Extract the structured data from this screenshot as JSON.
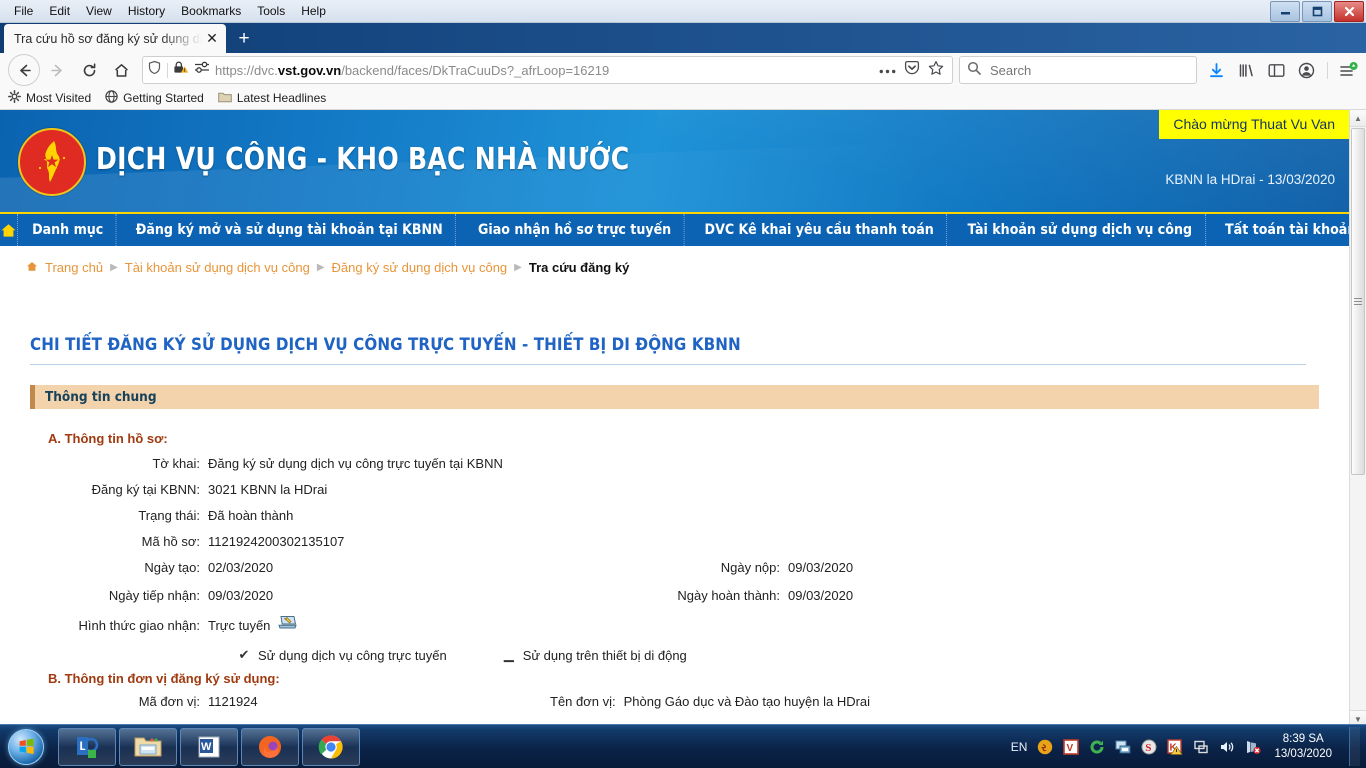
{
  "browser": {
    "menus": [
      "File",
      "Edit",
      "View",
      "History",
      "Bookmarks",
      "Tools",
      "Help"
    ],
    "tab_title": "Tra cứu hồ sơ đăng ký sử dụng dịch",
    "new_tab_label": "+",
    "close_tab_label": "✕",
    "url_prefix": "https://dvc.",
    "url_domain": "vst.gov.vn",
    "url_suffix": "/backend/faces/DkTraCuuDs?_afrLoop=16219",
    "search_placeholder": "Search",
    "bookmarks": [
      "Most Visited",
      "Getting Started",
      "Latest Headlines"
    ],
    "window_controls": {
      "minimize": "—",
      "maximize": "❐",
      "close": "✕"
    }
  },
  "site": {
    "title": "DỊCH VỤ CÔNG - KHO BẠC NHÀ NƯỚC",
    "welcome": "Chào mừng Thuat Vu Van",
    "office_date": "KBNN la HDrai - 13/03/2020",
    "nav": [
      "Danh mục",
      "Đăng ký mở và sử dụng tài khoản tại KBNN",
      "Giao nhận hồ sơ trực tuyến",
      "DVC Kê khai yêu cầu thanh toán",
      "Tài khoản sử dụng dịch vụ công",
      "Tất toán tài khoản"
    ]
  },
  "breadcrumb": {
    "items": [
      "Trang chủ",
      "Tài khoản sử dụng dịch vụ công",
      "Đăng ký sử dụng dịch vụ công"
    ],
    "current": "Tra cứu đăng ký",
    "separator": "▶"
  },
  "page": {
    "title": "CHI TIẾT ĐĂNG KÝ SỬ DỤNG DỊCH VỤ CÔNG TRỰC TUYẾN - THIẾT BỊ DI ĐỘNG KBNN",
    "section_title": "Thông tin chung",
    "section_a_title": "A. Thông tin hồ sơ:",
    "section_b_title": "B. Thông tin đơn vị đăng ký sử dụng:",
    "fields": {
      "to_khai_label": "Tờ khai:",
      "to_khai_value": "Đăng ký sử dụng dịch vụ công trực tuyến tại KBNN",
      "dang_ky_label": "Đăng ký tại KBNN:",
      "dang_ky_value": "3021  KBNN la HDrai",
      "trang_thai_label": "Trạng thái:",
      "trang_thai_value": "Đã hoàn thành",
      "ma_ho_so_label": "Mã hồ sơ:",
      "ma_ho_so_value": "1121924200302135107",
      "ngay_tao_label": "Ngày tạo:",
      "ngay_tao_value": "02/03/2020",
      "ngay_nop_label": "Ngày nộp:",
      "ngay_nop_value": "09/03/2020",
      "ngay_tiep_nhan_label": "Ngày tiếp nhận:",
      "ngay_tiep_nhan_value": "09/03/2020",
      "ngay_hoan_thanh_label": "Ngày hoàn thành:",
      "ngay_hoan_thanh_value": "09/03/2020",
      "hinh_thuc_label": "Hình thức giao nhận:",
      "hinh_thuc_value": "Trực tuyến",
      "check1_mark": "✔",
      "check1_label": "Sử dụng dịch vụ công trực tuyến",
      "check2_mark": "▁",
      "check2_label": "Sử dụng trên thiết bị di động",
      "ma_don_vi_label": "Mã đơn vị:",
      "ma_don_vi_value": "1121924",
      "ten_don_vi_label": "Tên đơn vị:",
      "ten_don_vi_value": "Phòng Gáo dục và Đào tạo huyện la HDrai"
    }
  },
  "taskbar": {
    "language": "EN",
    "time": "8:39 SA",
    "date": "13/03/2020"
  },
  "colors": {
    "header_blue": "#1277c4",
    "nav_blue": "#0d63b3",
    "accent_yellow": "#ffff00",
    "section_bar": "#f3d3ab",
    "title_blue": "#1f63c4",
    "subhead_brown": "#a03a11"
  }
}
